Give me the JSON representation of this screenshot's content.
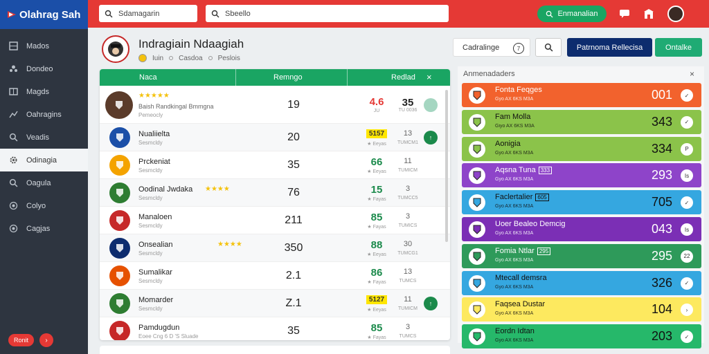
{
  "app": {
    "brand": "Olahrag Sah"
  },
  "sidebar": {
    "items": [
      {
        "label": "Mados",
        "icon": "grid-icon"
      },
      {
        "label": "Dondeo",
        "icon": "users-icon"
      },
      {
        "label": "Magds",
        "icon": "board-icon"
      },
      {
        "label": "Oahragins",
        "icon": "chart-icon"
      },
      {
        "label": "Veadis",
        "icon": "search-icon"
      },
      {
        "label": "Odinagia",
        "icon": "gear-icon",
        "active": true
      },
      {
        "label": "Oagula",
        "icon": "search-icon"
      },
      {
        "label": "Colyo",
        "icon": "target-icon"
      },
      {
        "label": "Cagjas",
        "icon": "target-icon"
      }
    ],
    "bottom_pill": "Ronit",
    "bottom_circle": "›"
  },
  "topbar": {
    "search1_value": "Sdamagarin",
    "search2_value": "Sbeello",
    "cta_label": "Enmanalian"
  },
  "header": {
    "title": "Indragiain Ndaagiah",
    "meta": [
      "Iuin",
      "Casdoa",
      "Peslois"
    ],
    "input_value": "Cadralinge",
    "input_badge": "7",
    "btn_primary": "Patrnoma Rellecisa",
    "btn_secondary": "Ontalke"
  },
  "table": {
    "columns": [
      "Naca",
      "Remngo",
      "Redlad"
    ],
    "rows": [
      {
        "name": "",
        "stars": "★★★★★",
        "sub": "Baish Randkingal Bmmgna",
        "sub2": "Pemeocly",
        "rank": "19",
        "score": "4.6",
        "score_color": "#e53935",
        "score_sub": "JU",
        "stat": "35",
        "stat_sub": "TU 0036",
        "btn": "",
        "btn_color": "#a5d6c1",
        "logo_color": "#5b3b2a"
      },
      {
        "name": "Nualiielta",
        "stars": "",
        "sub": "Sesmcldy",
        "sub2": "",
        "rank": "20",
        "score": "5157",
        "score_style": "yellow",
        "score_sub": "★ Eeyas",
        "stat": "13",
        "stat_sub": "TUMCM1",
        "btn": "↑",
        "btn_color": "#1b8a4b",
        "logo_color": "#1b4fa8"
      },
      {
        "name": "Prckeniat",
        "stars": "",
        "sub": "Sesmcldy",
        "sub2": "",
        "rank": "35",
        "score": "66",
        "score_color": "#1b8a4b",
        "score_sub": "★ Eeyas",
        "stat": "11",
        "stat_sub": "TUMICM",
        "btn": "",
        "btn_color": "",
        "logo_color": "#f4a300"
      },
      {
        "name": "Oodinal Jwdaka",
        "stars": "★★★★",
        "sub": "Sesmcldy",
        "sub2": "",
        "rank": "76",
        "score": "15",
        "score_color": "#1b8a4b",
        "score_sub": "★ Fayas",
        "stat": "3",
        "stat_sub": "TUMCC5",
        "btn": "",
        "btn_color": "",
        "logo_color": "#2e7d32"
      },
      {
        "name": "Manaloen",
        "stars": "",
        "sub": "Sesmcldy",
        "sub2": "",
        "rank": "211",
        "score": "85",
        "score_color": "#1b8a4b",
        "score_sub": "★ Fayas",
        "stat": "3",
        "stat_sub": "TUMICS",
        "btn": "",
        "btn_color": "",
        "logo_color": "#c62828"
      },
      {
        "name": "Onsealian",
        "stars": "★★★★",
        "sub": "Sesmcldy",
        "sub2": "",
        "rank": "350",
        "score": "88",
        "score_color": "#1b8a4b",
        "score_sub": "★ Eeyas",
        "stat": "30",
        "stat_sub": "TUMCG1",
        "btn": "",
        "btn_color": "",
        "logo_color": "#0d2c6e"
      },
      {
        "name": "Sumalikar",
        "stars": "",
        "sub": "Sesmcldy",
        "sub2": "",
        "rank": "2.1",
        "score": "86",
        "score_color": "#1b8a4b",
        "score_sub": "★ Fayas",
        "stat": "13",
        "stat_sub": "TUMCS",
        "btn": "",
        "btn_color": "",
        "logo_color": "#e65100"
      },
      {
        "name": "Momarder",
        "stars": "",
        "sub": "Sesmcldy",
        "sub2": "",
        "rank": "Z.1",
        "score": "5127",
        "score_style": "yellow",
        "score_sub": "★ Eeyas",
        "stat": "11",
        "stat_sub": "TUMICM",
        "btn": "↑",
        "btn_color": "#1b8a4b",
        "logo_color": "#2e7d32"
      },
      {
        "name": "Pamdugdun",
        "stars": "",
        "sub": "Eoee Cng 6 D 'S Sluade",
        "sub2": "",
        "rank": "35",
        "score": "85",
        "score_color": "#1b8a4b",
        "score_sub": "★ Fayas",
        "stat": "3",
        "stat_sub": "TUMCS",
        "btn": "",
        "btn_color": "",
        "logo_color": "#c62828"
      }
    ]
  },
  "right_panel": {
    "title": "Anmenadaders",
    "cards": [
      {
        "title": "Fonta Feqges",
        "sub": "Gyo AX 6KS M3A",
        "tag": "",
        "value": "001",
        "btn": "✓",
        "bg": "#f2622d",
        "fg": "#fff"
      },
      {
        "title": "Fam Molla",
        "sub": "Giyo AX 6KS M3A",
        "tag": "",
        "value": "343",
        "btn": "✓",
        "bg": "#8bc34a",
        "fg": "#111"
      },
      {
        "title": "Aonigia",
        "sub": "Gyo AX 6KS M3A",
        "tag": "",
        "value": "334",
        "btn": "P",
        "bg": "#8bc34a",
        "fg": "#111"
      },
      {
        "title": "Aqsna Tuna",
        "sub": "Gyo AX 6KS M3A",
        "tag": "333",
        "value": "293",
        "btn": "Is",
        "bg": "#8e44c9",
        "fg": "#fff"
      },
      {
        "title": "Faclertalier",
        "sub": "Gyo AX 6KS M3A",
        "tag": "605",
        "value": "705",
        "btn": "✓",
        "bg": "#35a7e0",
        "fg": "#111"
      },
      {
        "title": "Uoer Bealeo Demcig",
        "sub": "Gyo AX 6KS M3A",
        "tag": "",
        "value": "043",
        "btn": "Is",
        "bg": "#7b2fb5",
        "fg": "#fff"
      },
      {
        "title": "Fomia Ntlar",
        "sub": "Gyo AX 6KS M3A",
        "tag": "295",
        "value": "295",
        "btn": "22",
        "bg": "#2e9a5a",
        "fg": "#fff"
      },
      {
        "title": "Mtecall demsra",
        "sub": "Gyo AX 6KS M3A",
        "tag": "",
        "value": "326",
        "btn": "✓",
        "bg": "#35a7e0",
        "fg": "#111"
      },
      {
        "title": "Faqsea Dustar",
        "sub": "Gyo AX 6KS M3A",
        "tag": "",
        "value": "104",
        "btn": "›",
        "bg": "#fde95f",
        "fg": "#111"
      },
      {
        "title": "Eordn Idtan",
        "sub": "Gyo AX 6KS M3A",
        "tag": "",
        "value": "203",
        "btn": "✓",
        "bg": "#26b86a",
        "fg": "#111"
      }
    ]
  }
}
